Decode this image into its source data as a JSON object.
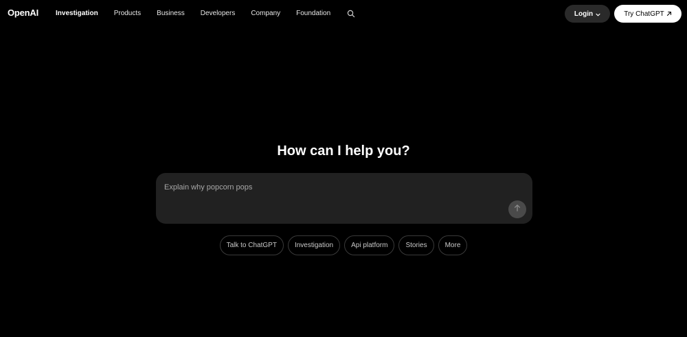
{
  "header": {
    "logo": "OpenAI",
    "nav": [
      {
        "label": "Investigation",
        "active": true
      },
      {
        "label": "Products",
        "active": false
      },
      {
        "label": "Business",
        "active": false
      },
      {
        "label": "Developers",
        "active": false
      },
      {
        "label": "Company",
        "active": false
      },
      {
        "label": "Foundation",
        "active": false
      }
    ],
    "search_icon": "search-icon",
    "login_label": "Login",
    "try_label": "Try ChatGPT"
  },
  "hero": {
    "title": "How can I help you?"
  },
  "prompt": {
    "placeholder": "Explain why popcorn pops",
    "value": ""
  },
  "chips": [
    {
      "label": "Talk to ChatGPT"
    },
    {
      "label": "Investigation"
    },
    {
      "label": "Api platform"
    },
    {
      "label": "Stories"
    },
    {
      "label": "More"
    }
  ],
  "colors": {
    "background": "#000000",
    "prompt_bg": "#212121",
    "login_bg": "#2a2a2a",
    "try_bg": "#ffffff"
  }
}
